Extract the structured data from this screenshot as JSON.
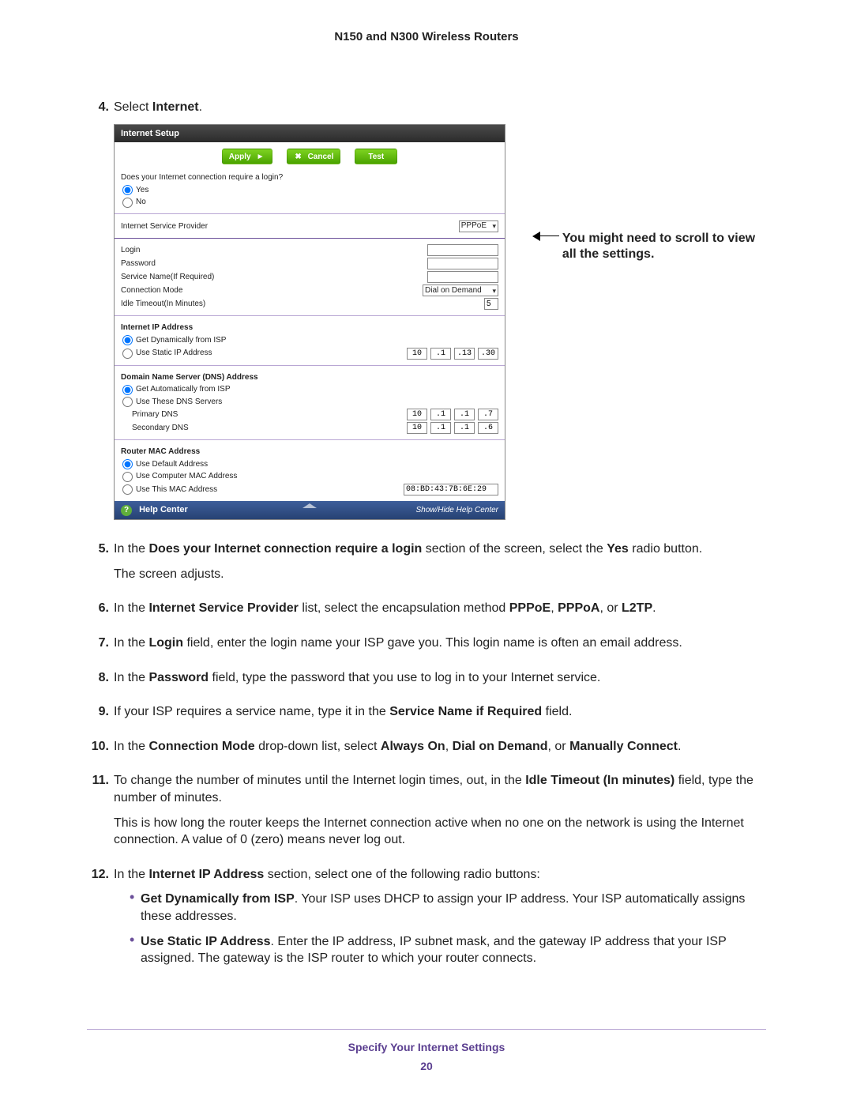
{
  "doc_title": "N150 and N300 Wireless Routers",
  "callout": "You might need to scroll to view all the settings.",
  "footer": {
    "section": "Specify Your Internet Settings",
    "page": "20"
  },
  "shot": {
    "title": "Internet Setup",
    "buttons": {
      "apply": "Apply",
      "apply_sym": "►",
      "cancel": "Cancel",
      "cancel_sym": "✖",
      "test": "Test"
    },
    "q_login": "Does your Internet connection require a login?",
    "opt_yes": "Yes",
    "opt_no": "No",
    "isp_label": "Internet Service Provider",
    "isp_value": "PPPoE",
    "login_label": "Login",
    "password_label": "Password",
    "service_label": "Service Name(If Required)",
    "conn_mode_label": "Connection Mode",
    "conn_mode_value": "Dial on Demand",
    "idle_label": "Idle Timeout(In Minutes)",
    "idle_value": "5",
    "ip_header": "Internet IP Address",
    "ip_dyn": "Get Dynamically from ISP",
    "ip_static": "Use Static IP Address",
    "static_ip": {
      "a": "10",
      "b": ".1",
      "c": ".13",
      "d": ".30"
    },
    "dns_header": "Domain Name Server (DNS) Address",
    "dns_auto": "Get Automatically from ISP",
    "dns_manual": "Use These DNS Servers",
    "dns_primary_label": "Primary DNS",
    "dns_primary": {
      "a": "10",
      "b": ".1",
      "c": ".1",
      "d": ".7"
    },
    "dns_secondary_label": "Secondary DNS",
    "dns_secondary": {
      "a": "10",
      "b": ".1",
      "c": ".1",
      "d": ".6"
    },
    "mac_header": "Router MAC Address",
    "mac_default": "Use Default Address",
    "mac_computer": "Use Computer MAC Address",
    "mac_this": "Use This MAC Address",
    "mac_value": "08:BD:43:7B:6E:29",
    "help_center": "Help Center",
    "help_toggle": "Show/Hide Help Center"
  },
  "steps": {
    "s4": {
      "n": "4.",
      "t1": "Select ",
      "t2": "Internet",
      "t3": "."
    },
    "s5": {
      "n": "5.",
      "a": "In the ",
      "b": "Does your Internet connection require a login",
      "c": " section of the screen, select the ",
      "d": "Yes",
      "e": " radio button.",
      "p2": "The screen adjusts."
    },
    "s6": {
      "n": "6.",
      "a": "In the ",
      "b": "Internet Service Provider",
      "c": " list, select the encapsulation method ",
      "d": "PPPoE",
      "e": ", ",
      "f": "PPPoA",
      "g": ", or ",
      "h": "L2TP",
      "i": "."
    },
    "s7": {
      "n": "7.",
      "a": "In the ",
      "b": "Login",
      "c": " field, enter the login name your ISP gave you. This login name is often an email address."
    },
    "s8": {
      "n": "8.",
      "a": "In the ",
      "b": "Password",
      "c": " field, type the password that you use to log in to your Internet service."
    },
    "s9": {
      "n": "9.",
      "a": "If your ISP requires a service name, type it in the ",
      "b": "Service Name if Required",
      "c": " field."
    },
    "s10": {
      "n": "10.",
      "a": "In the ",
      "b": "Connection Mode",
      "c": " drop-down list, select ",
      "d": "Always On",
      "e": ", ",
      "f": "Dial on Demand",
      "g": ", or ",
      "h": "Manually Connect",
      "i": "."
    },
    "s11": {
      "n": "11.",
      "a": "To change the number of minutes until the Internet login times, out, in the ",
      "b": "Idle Timeout (In minutes)",
      "c": " field, type the number of minutes.",
      "p2": "This is how long the router keeps the Internet connection active when no one on the network is using the Internet connection. A value of 0 (zero) means never log out."
    },
    "s12": {
      "n": "12.",
      "a": "In the ",
      "b": "Internet IP Address",
      "c": " section, select one of the following radio buttons:",
      "bul1a": "Get Dynamically from ISP",
      "bul1b": ". Your ISP uses DHCP to assign your IP address. Your ISP automatically assigns these addresses.",
      "bul2a": "Use Static IP Address",
      "bul2b": ". Enter the IP address, IP subnet mask, and the gateway IP address that your ISP assigned. The gateway is the ISP router to which your router connects."
    }
  }
}
